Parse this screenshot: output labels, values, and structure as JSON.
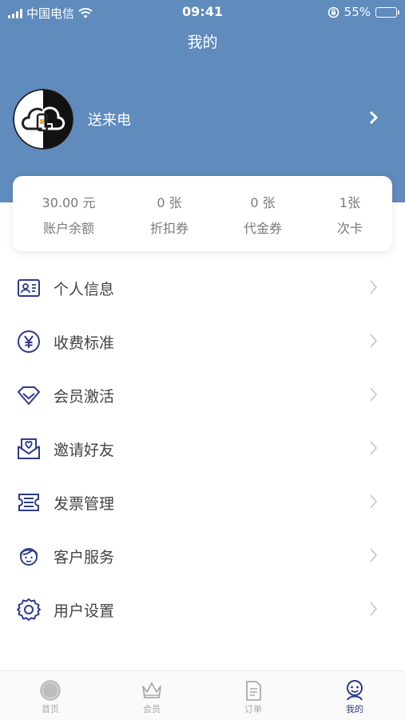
{
  "status_bar": {
    "carrier": "中国电信",
    "time": "09:41",
    "battery": "55%"
  },
  "header": {
    "title": "我的"
  },
  "profile": {
    "name": "送来电"
  },
  "stats": [
    {
      "value": "30.00 元",
      "label": "账户余额"
    },
    {
      "value": "0 张",
      "label": "折扣券"
    },
    {
      "value": "0 张",
      "label": "代金券"
    },
    {
      "value": "1张",
      "label": "次卡"
    }
  ],
  "menu": [
    {
      "label": "个人信息",
      "icon": "id-card-icon"
    },
    {
      "label": "收费标准",
      "icon": "yen-icon"
    },
    {
      "label": "会员激活",
      "icon": "diamond-icon"
    },
    {
      "label": "邀请好友",
      "icon": "invite-envelope-icon"
    },
    {
      "label": "发票管理",
      "icon": "invoice-icon"
    },
    {
      "label": "客户服务",
      "icon": "customer-service-icon"
    },
    {
      "label": "用户设置",
      "icon": "settings-gear-icon"
    }
  ],
  "tabbar": [
    {
      "label": "首页",
      "icon": "home-icon",
      "active": false
    },
    {
      "label": "会员",
      "icon": "crown-icon",
      "active": false
    },
    {
      "label": "订单",
      "icon": "order-document-icon",
      "active": false
    },
    {
      "label": "我的",
      "icon": "user-face-icon",
      "active": true
    }
  ],
  "colors": {
    "header": "#5f8bbd",
    "icon": "#2e3b8c",
    "active_tab": "#2e3b8c",
    "inactive_tab": "#a8a8a8"
  }
}
